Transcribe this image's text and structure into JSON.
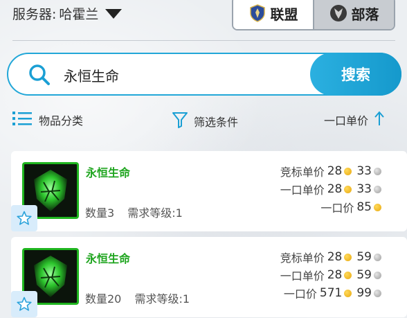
{
  "header": {
    "server_label": "服务器:",
    "server_value": "哈霍兰",
    "factions": [
      {
        "label": "联盟",
        "active": true
      },
      {
        "label": "部落",
        "active": false
      }
    ]
  },
  "search": {
    "query": "永恒生命",
    "button_label": "搜索"
  },
  "filters": {
    "category_label": "物品分类",
    "filter_label": "筛选条件",
    "sort_label": "一口单价"
  },
  "items": [
    {
      "name": "永恒生命",
      "quantity_label": "数量3",
      "level_label": "需求等级:1",
      "bid_unit_label": "竞标单价",
      "bid_unit_gold": "28",
      "bid_unit_silver": "33",
      "buyout_unit_label": "一口单价",
      "buyout_unit_gold": "28",
      "buyout_unit_silver": "33",
      "buyout_label": "一口价",
      "buyout_gold": "85"
    },
    {
      "name": "永恒生命",
      "quantity_label": "数量20",
      "level_label": "需求等级:1",
      "bid_unit_label": "竞标单价",
      "bid_unit_gold": "28",
      "bid_unit_silver": "59",
      "buyout_unit_label": "一口单价",
      "buyout_unit_gold": "28",
      "buyout_unit_silver": "59",
      "buyout_label": "一口价",
      "buyout_gold": "571",
      "buyout_silver": "99"
    }
  ],
  "colors": {
    "accent": "#22a7d8",
    "item_name": "#1fa51f",
    "gold_coin": "#e8a80f",
    "silver_coin": "#9c9c9c"
  },
  "icons": {
    "faction_alliance": "alliance-emblem-icon",
    "faction_horde": "horde-emblem-icon",
    "search": "search-icon",
    "category": "list-icon",
    "filter": "funnel-icon",
    "sort": "arrow-up-icon",
    "favorite": "star-icon"
  }
}
